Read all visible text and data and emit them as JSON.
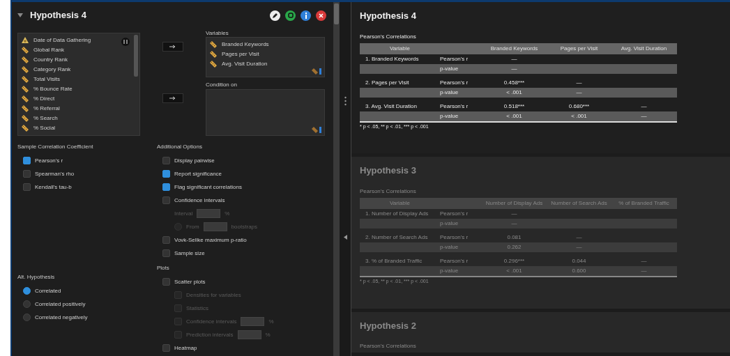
{
  "analysis": {
    "title": "Hypothesis 4",
    "expanded": true
  },
  "source_variables": [
    {
      "name": "Date of Data Gathering",
      "kind": "nominal"
    },
    {
      "name": "Global Rank",
      "kind": "scale"
    },
    {
      "name": "Country Rank",
      "kind": "scale"
    },
    {
      "name": "Category Rank",
      "kind": "scale"
    },
    {
      "name": "Total Visits",
      "kind": "scale"
    },
    {
      "name": "% Bounce Rate",
      "kind": "scale"
    },
    {
      "name": "% Direct",
      "kind": "scale"
    },
    {
      "name": "% Referral",
      "kind": "scale"
    },
    {
      "name": "% Search",
      "kind": "scale"
    },
    {
      "name": "% Social",
      "kind": "scale"
    }
  ],
  "variables_box": {
    "label": "Variables",
    "items": [
      {
        "name": "Branded Keywords",
        "kind": "scale"
      },
      {
        "name": "Pages per Visit",
        "kind": "scale"
      },
      {
        "name": "Avg. Visit Duration",
        "kind": "scale"
      }
    ]
  },
  "condition_box": {
    "label": "Condition on"
  },
  "coefficient": {
    "label": "Sample Correlation Coefficient",
    "options": [
      {
        "kind": "checkbox",
        "label": "Pearson's r",
        "checked": true,
        "disabled": false
      },
      {
        "kind": "checkbox",
        "label": "Spearman's rho",
        "checked": false,
        "disabled": false
      },
      {
        "kind": "checkbox",
        "label": "Kendall's tau-b",
        "checked": false,
        "disabled": false
      }
    ]
  },
  "additional": {
    "label": "Additional Options",
    "options": [
      {
        "kind": "checkbox",
        "label": "Display pairwise",
        "checked": false,
        "disabled": false
      },
      {
        "kind": "checkbox",
        "label": "Report significance",
        "checked": true,
        "disabled": false
      },
      {
        "kind": "checkbox",
        "label": "Flag significant correlations",
        "checked": true,
        "disabled": false
      },
      {
        "kind": "checkbox",
        "label": "Confidence intervals",
        "checked": false,
        "disabled": false,
        "children": [
          {
            "kind": "field",
            "label": "Interval",
            "unit": "%",
            "disabled": true
          },
          {
            "kind": "radio_field",
            "label": "From",
            "unit": "bootstraps",
            "selected": false,
            "disabled": true
          }
        ]
      },
      {
        "kind": "checkbox",
        "label": "Vovk-Sellke maximum p-ratio",
        "checked": false,
        "disabled": false
      },
      {
        "kind": "checkbox",
        "label": "Sample size",
        "checked": false,
        "disabled": false
      }
    ]
  },
  "hypotheses": {
    "label": "Alt. Hypothesis",
    "options": [
      {
        "kind": "radio",
        "label": "Correlated",
        "selected": true,
        "disabled": false
      },
      {
        "kind": "radio",
        "label": "Correlated positively",
        "selected": false,
        "disabled": false
      },
      {
        "kind": "radio",
        "label": "Correlated negatively",
        "selected": false,
        "disabled": false
      }
    ]
  },
  "plots": {
    "label": "Plots",
    "options": [
      {
        "kind": "checkbox",
        "label": "Scatter plots",
        "checked": false,
        "disabled": false,
        "children": [
          {
            "kind": "checkbox",
            "label": "Densities for variables",
            "checked": false,
            "disabled": true
          },
          {
            "kind": "checkbox",
            "label": "Statistics",
            "checked": false,
            "disabled": true
          },
          {
            "kind": "check_field",
            "label": "Confidence intervals",
            "unit": "%",
            "checked": false,
            "disabled": true
          },
          {
            "kind": "check_field",
            "label": "Prediction intervals",
            "unit": "%",
            "checked": false,
            "disabled": true
          }
        ]
      },
      {
        "kind": "checkbox",
        "label": "Heatmap",
        "checked": false,
        "disabled": false
      }
    ]
  },
  "results": [
    {
      "title": "Hypothesis 4",
      "dimmed": false,
      "table": {
        "title": "Pearson's Correlations",
        "columns": [
          "Variable",
          "",
          "Branded Keywords",
          "Pages per Visit",
          "Avg. Visit Duration"
        ],
        "rows": [
          {
            "cells": [
              "1. Branded Keywords",
              "Pearson's r",
              "—",
              "",
              ""
            ]
          },
          {
            "cells": [
              "",
              "p-value",
              "—",
              "",
              ""
            ]
          },
          {
            "cells": [
              "2. Pages per Visit",
              "Pearson's r",
              "0.458***",
              "—",
              ""
            ]
          },
          {
            "cells": [
              "",
              "p-value",
              "< .001",
              "—",
              ""
            ]
          },
          {
            "cells": [
              "3. Avg. Visit Duration",
              "Pearson's r",
              "0.518***",
              "0.680***",
              "—"
            ]
          },
          {
            "cells": [
              "",
              "p-value",
              "< .001",
              "< .001",
              "—"
            ]
          }
        ],
        "footnote": "* p < .05, ** p < .01, *** p < .001"
      }
    },
    {
      "title": "Hypothesis 3",
      "dimmed": true,
      "table": {
        "title": "Pearson's Correlations",
        "columns": [
          "Variable",
          "",
          "Number of Display Ads",
          "Number of Search Ads",
          "% of Branded Traffic"
        ],
        "rows": [
          {
            "cells": [
              "1. Number of Display Ads",
              "Pearson's r",
              "—",
              "",
              ""
            ]
          },
          {
            "cells": [
              "",
              "p-value",
              "—",
              "",
              ""
            ]
          },
          {
            "cells": [
              "2. Number of Search Ads",
              "Pearson's r",
              "0.081",
              "—",
              ""
            ]
          },
          {
            "cells": [
              "",
              "p-value",
              "0.262",
              "—",
              ""
            ]
          },
          {
            "cells": [
              "3. % of Branded Traffic",
              "Pearson's r",
              "0.296***",
              "0.044",
              "—"
            ]
          },
          {
            "cells": [
              "",
              "p-value",
              "< .001",
              "0.600",
              "—"
            ]
          }
        ],
        "footnote": "* p < .05, ** p < .01, *** p < .001"
      }
    },
    {
      "title": "Hypothesis 2",
      "dimmed": true,
      "table": {
        "title": "Pearson's Correlations"
      }
    }
  ]
}
